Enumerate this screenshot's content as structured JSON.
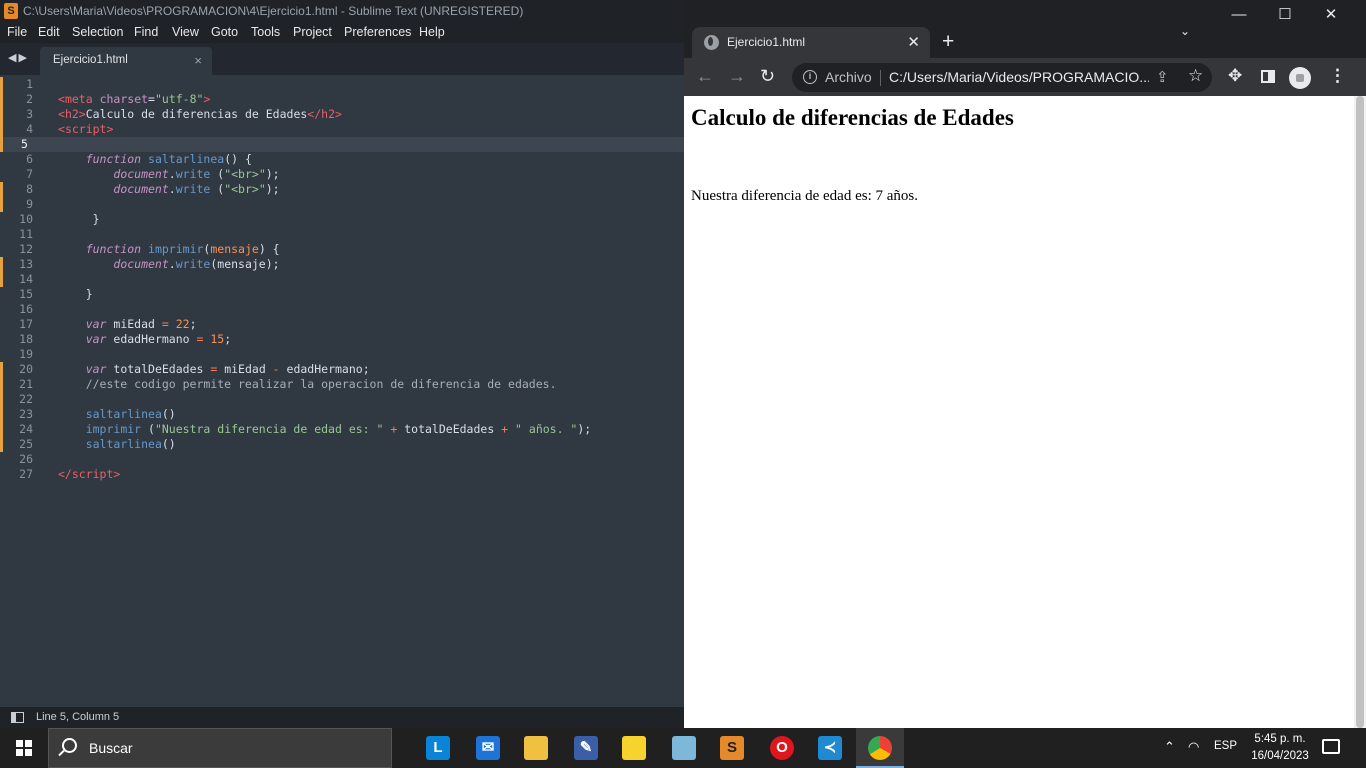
{
  "sublime": {
    "title": "C:\\Users\\Maria\\Videos\\PROGRAMACION\\4\\Ejercicio1.html - Sublime Text (UNREGISTERED)",
    "menu": [
      "File",
      "Edit",
      "Selection",
      "Find",
      "View",
      "Goto",
      "Tools",
      "Project",
      "Preferences",
      "Help"
    ],
    "tab_label": "Ejercicio1.html",
    "line_numbers": [
      "1",
      "2",
      "3",
      "4",
      "5",
      "6",
      "7",
      "8",
      "9",
      "10",
      "11",
      "12",
      "13",
      "14",
      "15",
      "16",
      "17",
      "18",
      "19",
      "20",
      "21",
      "22",
      "23",
      "24",
      "25",
      "26",
      "27"
    ],
    "active_line": "5",
    "modified_lines": [
      "1",
      "2",
      "3",
      "4",
      "5",
      "8",
      "9",
      "13",
      "14",
      "20",
      "21",
      "22",
      "23",
      "24",
      "25"
    ],
    "code": [
      [],
      [
        [
          "t-tag",
          "<"
        ],
        [
          "t-tag",
          "meta"
        ],
        [
          "t-pl",
          " "
        ],
        [
          "t-attr",
          "charset"
        ],
        [
          "t-pl",
          "="
        ],
        [
          "t-str",
          "\"utf-8\""
        ],
        [
          "t-tag",
          ">"
        ]
      ],
      [
        [
          "t-tag",
          "<"
        ],
        [
          "t-tag",
          "h2"
        ],
        [
          "t-tag",
          ">"
        ],
        [
          "t-pl",
          "Calculo de diferencias de Edades"
        ],
        [
          "t-tag",
          "</"
        ],
        [
          "t-tag",
          "h2"
        ],
        [
          "t-tag",
          ">"
        ]
      ],
      [
        [
          "t-tag",
          "<"
        ],
        [
          "t-tag",
          "script"
        ],
        [
          "t-tag",
          ">"
        ]
      ],
      [],
      [
        [
          "t-pl",
          "    "
        ],
        [
          "t-kw",
          "function"
        ],
        [
          "t-pl",
          " "
        ],
        [
          "t-fn",
          "saltarlinea"
        ],
        [
          "t-pl",
          "() {"
        ]
      ],
      [
        [
          "t-pl",
          "        "
        ],
        [
          "t-kw",
          "document"
        ],
        [
          "t-pl",
          "."
        ],
        [
          "t-fn",
          "write"
        ],
        [
          "t-pl",
          " ("
        ],
        [
          "t-str",
          "\"<br>\""
        ],
        [
          "t-pl",
          ");"
        ]
      ],
      [
        [
          "t-pl",
          "        "
        ],
        [
          "t-kw",
          "document"
        ],
        [
          "t-pl",
          "."
        ],
        [
          "t-fn",
          "write"
        ],
        [
          "t-pl",
          " ("
        ],
        [
          "t-str",
          "\"<br>\""
        ],
        [
          "t-pl",
          ");"
        ]
      ],
      [],
      [
        [
          "t-pl",
          "     }"
        ]
      ],
      [],
      [
        [
          "t-pl",
          "    "
        ],
        [
          "t-kw",
          "function"
        ],
        [
          "t-pl",
          " "
        ],
        [
          "t-fn",
          "imprimir"
        ],
        [
          "t-pl",
          "("
        ],
        [
          "t-param",
          "mensaje"
        ],
        [
          "t-pl",
          ") {"
        ]
      ],
      [
        [
          "t-pl",
          "        "
        ],
        [
          "t-kw",
          "document"
        ],
        [
          "t-pl",
          "."
        ],
        [
          "t-fn",
          "write"
        ],
        [
          "t-pl",
          "(mensaje);"
        ]
      ],
      [],
      [
        [
          "t-pl",
          "    }"
        ]
      ],
      [],
      [
        [
          "t-pl",
          "    "
        ],
        [
          "t-kw",
          "var"
        ],
        [
          "t-pl",
          " miEdad "
        ],
        [
          "t-op",
          "="
        ],
        [
          "t-pl",
          " "
        ],
        [
          "t-num",
          "22"
        ],
        [
          "t-pl",
          ";"
        ]
      ],
      [
        [
          "t-pl",
          "    "
        ],
        [
          "t-kw",
          "var"
        ],
        [
          "t-pl",
          " edadHermano "
        ],
        [
          "t-op",
          "="
        ],
        [
          "t-pl",
          " "
        ],
        [
          "t-num",
          "15"
        ],
        [
          "t-pl",
          ";"
        ]
      ],
      [],
      [
        [
          "t-pl",
          "    "
        ],
        [
          "t-kw",
          "var"
        ],
        [
          "t-pl",
          " totalDeEdades "
        ],
        [
          "t-op",
          "="
        ],
        [
          "t-pl",
          " miEdad "
        ],
        [
          "t-op",
          "-"
        ],
        [
          "t-pl",
          " edadHermano;"
        ]
      ],
      [
        [
          "t-cm",
          "    //este codigo permite realizar la operacion de diferencia de edades."
        ]
      ],
      [],
      [
        [
          "t-pl",
          "    "
        ],
        [
          "t-fn",
          "saltarlinea"
        ],
        [
          "t-pl",
          "()"
        ]
      ],
      [
        [
          "t-pl",
          "    "
        ],
        [
          "t-fn",
          "imprimir"
        ],
        [
          "t-pl",
          " ("
        ],
        [
          "t-str",
          "\"Nuestra diferencia de edad es: \""
        ],
        [
          "t-pl",
          " "
        ],
        [
          "t-op",
          "+"
        ],
        [
          "t-pl",
          " totalDeEdades "
        ],
        [
          "t-op",
          "+"
        ],
        [
          "t-pl",
          " "
        ],
        [
          "t-str",
          "\" años. \""
        ],
        [
          "t-pl",
          ");"
        ]
      ],
      [
        [
          "t-pl",
          "    "
        ],
        [
          "t-fn",
          "saltarlinea"
        ],
        [
          "t-pl",
          "()"
        ]
      ],
      [],
      [
        [
          "t-tag",
          "</"
        ],
        [
          "t-tag",
          "script"
        ],
        [
          "t-tag",
          ">"
        ]
      ]
    ],
    "status": "Line 5, Column 5",
    "icons": {
      "logo": "sublime-logo-icon",
      "nav": "tab-nav-arrows-icon",
      "panel": "panel-toggle-icon"
    }
  },
  "chrome": {
    "tab_title": "Ejercicio1.html",
    "omnibox_label": "Archivo",
    "url": "C:/Users/Maria/Videos/PROGRAMACIO...",
    "page_heading": "Calculo de diferencias de Edades",
    "page_output": "Nuestra diferencia de edad es: 7 años."
  },
  "taskbar": {
    "search_placeholder": "Buscar",
    "language": "ESP",
    "time": "5:45 p. m.",
    "date": "16/04/2023",
    "apps": [
      "launcher",
      "mail",
      "file-explorer",
      "tool",
      "sticky-notes",
      "notepad",
      "sublime-text",
      "opera",
      "vscode",
      "chrome"
    ]
  },
  "colors": {
    "editor_bg": "#303841",
    "chrome_frame": "#202124",
    "taskbar": "#202020",
    "modified_marker": "#e6a23c"
  }
}
